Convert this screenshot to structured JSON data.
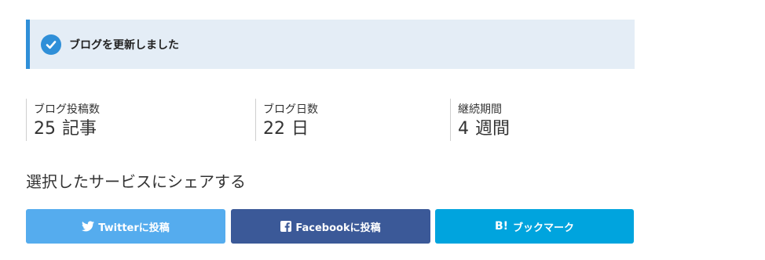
{
  "notice": {
    "message": "ブログを更新しました",
    "icon": "check-circle-icon",
    "accent_color": "#2f8fd8"
  },
  "stats": [
    {
      "label": "ブログ投稿数",
      "value": "25",
      "unit": "記事"
    },
    {
      "label": "ブログ日数",
      "value": "22",
      "unit": "日"
    },
    {
      "label": "継続期間",
      "value": "4",
      "unit": "週間"
    }
  ],
  "share": {
    "heading": "選択したサービスにシェアする",
    "buttons": [
      {
        "label": "Twitterに投稿",
        "icon": "twitter-icon",
        "color": "#55acee"
      },
      {
        "label": "Facebookに投稿",
        "icon": "facebook-icon",
        "color": "#3b5998"
      },
      {
        "label": "ブックマーク",
        "icon_text": "B!",
        "icon": "hatena-bookmark-icon",
        "color": "#00a4de"
      }
    ]
  }
}
